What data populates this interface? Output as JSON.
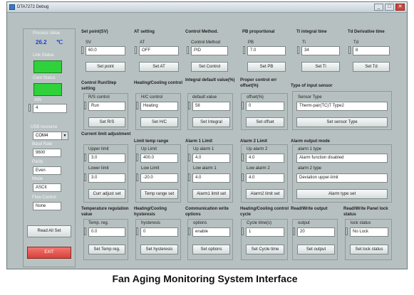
{
  "window": {
    "title": "DTA7272 Debug",
    "controls": [
      "_",
      "□",
      "✕"
    ]
  },
  "left_panel": {
    "process_value_label": "Process Value",
    "process_value": "26.2",
    "process_value_unit": "℃",
    "link_status_label": "Link Status",
    "card_status_label": "Card Status",
    "ain_label": "AIN",
    "ain_value": "4",
    "usb_resource_label": "USB resource",
    "usb_resource_value": "COM4",
    "baud_rate_label": "Baud Rate",
    "baud_rate_value": "9600",
    "parity_label": "Parity",
    "parity_value": "Even",
    "mode_label": "Mode",
    "mode_value": "ASCII",
    "flow_control_label": "Flow Control",
    "flow_control_value": "None",
    "read_all_button": "Read All Set",
    "exit_button": "EXIT"
  },
  "row1": [
    {
      "header": "Set point(SV)",
      "field_label": "SV",
      "value": "60.0",
      "button": "Set point"
    },
    {
      "header": "AT setting",
      "field_label": "AT",
      "value": "OFF",
      "button": "Set AT"
    },
    {
      "header": "Control Method.",
      "field_label": "Control Method",
      "value": "PID",
      "button": "Set Control"
    },
    {
      "header": "PB proportional",
      "field_label": "PB",
      "value": "7.0",
      "button": "Set PB"
    },
    {
      "header": "Ti integral time",
      "field_label": "Ti",
      "value": "34",
      "button": "Set Ti"
    },
    {
      "header": "Td Derivative time",
      "field_label": "Td",
      "value": "8",
      "button": "Set Td"
    }
  ],
  "row2": [
    {
      "header": "Control Run/Step setting",
      "field_label": "R/S control",
      "value": "Run",
      "button": "Set R/S"
    },
    {
      "header": "Heating/Cooling control",
      "field_label": "H/C control",
      "value": "Heating",
      "button": "Set H/C"
    },
    {
      "header": "Integral default value(%)",
      "field_label": "default value",
      "value": "58",
      "button": "Set Integral"
    },
    {
      "header": "Propor control err offset(%)",
      "field_label": "offset(%)",
      "value": "0",
      "button": "Set offset"
    },
    {
      "header": "Type of input sensor",
      "field_label": "Sensor Type",
      "value": "Therm-pair(TC)T Type2",
      "button": "Set sensor Type"
    }
  ],
  "row3": {
    "current_limit": {
      "header": "Current limit adjustment",
      "upper_label": "Upper limit",
      "upper_value": "3.0",
      "lower_label": "Lower limit",
      "lower_value": "3.0",
      "button": "Curr adjust set"
    },
    "limit_temp": {
      "header": "Limit temp range",
      "upper_label": "Up Limit",
      "upper_value": "400.0",
      "lower_label": "Low Limit",
      "lower_value": "-20.0",
      "button": "Temp range set"
    },
    "alarm1": {
      "header": "Alarm 1 Limit",
      "upper_label": "Up alarm 1",
      "upper_value": "4.0",
      "lower_label": "Low alarm 1",
      "lower_value": "4.0",
      "button": "Alarm1 limit set"
    },
    "alarm2": {
      "header": "Alarm 2 Limit",
      "upper_label": "Up alarm 2",
      "upper_value": "4.0",
      "lower_label": "Low alarm 2",
      "lower_value": "4.0",
      "button": "Alarm2 limit set"
    },
    "alarm_mode": {
      "header": "Alarm output mode",
      "type1_label": "alarm 1 type",
      "type1_value": "Alarm function disabled",
      "type2_label": "alarm 2 type",
      "type2_value": "Deviation upper-limit",
      "button": "Alarm type set"
    }
  },
  "row4": [
    {
      "header": "Temperature regulation value",
      "field_label": "Temp. reg.",
      "value": "0.0",
      "button": "Set Temp reg."
    },
    {
      "header": "Heating/Cooling hysteresis",
      "field_label": "hysteresis",
      "value": "0",
      "button": "Set hysteresis"
    },
    {
      "header": "Communication write options",
      "field_label": "options",
      "value": "enable",
      "button": "Set options"
    },
    {
      "header": "Heating/Cooling control cycle",
      "field_label": "Cycle time(s)",
      "value": "1",
      "button": "Set Cycle time"
    },
    {
      "header": "Read/Write output",
      "field_label": "output",
      "value": "20",
      "button": "Set output"
    },
    {
      "header": "Read/Write Panel lock status",
      "field_label": "lock status",
      "value": "No Lock",
      "button": "Set lock status"
    }
  ],
  "caption": "Fan Aging Monitoring System Interface",
  "colors": {
    "window_bg": "#b7c0c0",
    "status_green": "#2fd23a",
    "value_blue": "#1e3fd8",
    "exit_red": "#d8403a"
  }
}
